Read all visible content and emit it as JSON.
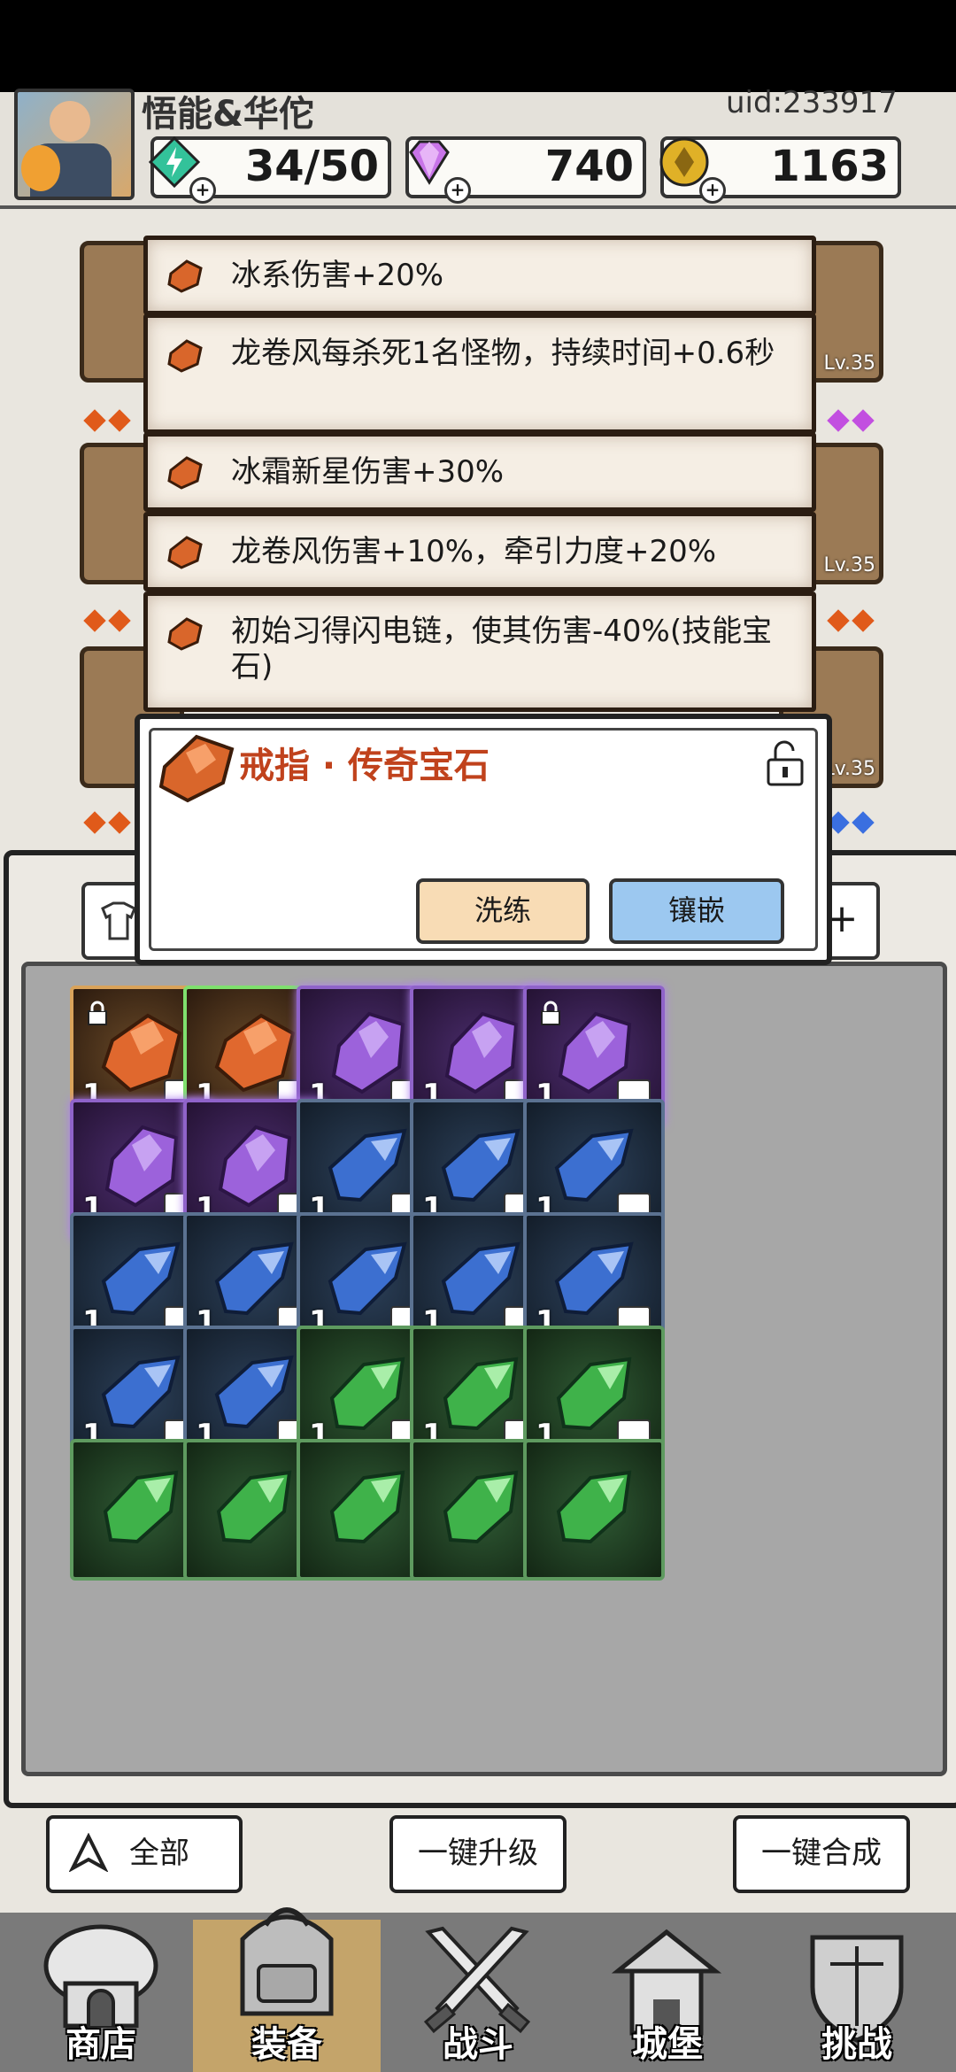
{
  "header": {
    "nickname": "悟能&华佗",
    "uid": "uid:233917",
    "stamina": "34/50",
    "diamonds": "740",
    "gold": "1163"
  },
  "slots": {
    "lv_right_1": "Lv.35",
    "lv_right_2": "Lv.35",
    "lv_right_3": "Lv.35"
  },
  "affixes": [
    {
      "text": "冰系伤害+20%"
    },
    {
      "text": "龙卷风每杀死1名怪物，持续时间+0.6秒"
    },
    {
      "text": "冰霜新星伤害+30%"
    },
    {
      "text": "龙卷风伤害+10%，牵引力度+20%"
    },
    {
      "text": "初始习得闪电链，使其伤害-40%(技能宝石)"
    }
  ],
  "gem_popup": {
    "title": "戒指 · 传奇宝石",
    "reroll_label": "洗练",
    "inlay_label": "镶嵌"
  },
  "inventory": {
    "count_label": "1",
    "plus_label": "+"
  },
  "controls": {
    "filter_label": "全部",
    "upgrade_all_label": "一键升级",
    "merge_all_label": "一键合成"
  },
  "nav": [
    {
      "label": "商店"
    },
    {
      "label": "装备"
    },
    {
      "label": "战斗"
    },
    {
      "label": "城堡"
    },
    {
      "label": "挑战"
    }
  ],
  "colors": {
    "legendary": "#d9662b",
    "epic": "#8f5fd8",
    "rare": "#3f6fc9",
    "uncommon": "#3fa04a"
  }
}
